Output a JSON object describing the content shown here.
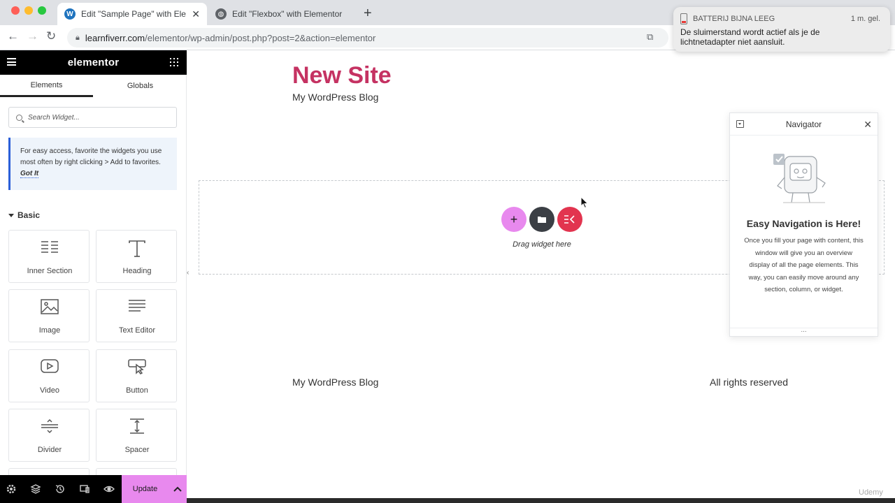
{
  "browser": {
    "tabs": [
      {
        "label": "Edit \"Sample Page\" with Eleme",
        "favicon": "wordpress-icon",
        "active": true
      },
      {
        "label": "Edit \"Flexbox\" with Elementor",
        "favicon": "globe-icon",
        "active": false
      }
    ],
    "url_host": "learnfiverr.com",
    "url_path": "/elementor/wp-admin/post.php?post=2&action=elementor"
  },
  "notification": {
    "app": "BATTERIJ BIJNA LEEG",
    "time": "1 m. gel.",
    "message": "De sluimerstand wordt actief als je de lichtnetadapter niet aansluit."
  },
  "panel": {
    "brand": "elementor",
    "tabs": [
      "Elements",
      "Globals"
    ],
    "search_placeholder": "Search Widget...",
    "tip_text": "For easy access, favorite the widgets you use most often by right clicking > Add to favorites.",
    "tip_action": "Got It",
    "category": "Basic",
    "widgets": [
      {
        "label": "Inner Section",
        "icon": "inner-section-icon"
      },
      {
        "label": "Heading",
        "icon": "heading-icon"
      },
      {
        "label": "Image",
        "icon": "image-icon"
      },
      {
        "label": "Text Editor",
        "icon": "text-editor-icon"
      },
      {
        "label": "Video",
        "icon": "video-icon"
      },
      {
        "label": "Button",
        "icon": "button-icon"
      },
      {
        "label": "Divider",
        "icon": "divider-icon"
      },
      {
        "label": "Spacer",
        "icon": "spacer-icon"
      }
    ],
    "update_label": "Update"
  },
  "canvas": {
    "site_title": "New Site",
    "tagline": "My WordPress Blog",
    "drag_label": "Drag widget here",
    "footer_left": "My WordPress Blog",
    "footer_right": "All rights reserved"
  },
  "navigator": {
    "title": "Navigator",
    "heading": "Easy Navigation is Here!",
    "description": "Once you fill your page with content, this window will give you an overview display of all the page elements. This way, you can easily move around any section, column, or widget.",
    "footer": "..."
  },
  "watermark": "Udemy",
  "colors": {
    "accent": "#e889ee",
    "brand_red": "#e2344f",
    "title": "#c53262",
    "dark": "#3b3f45"
  }
}
